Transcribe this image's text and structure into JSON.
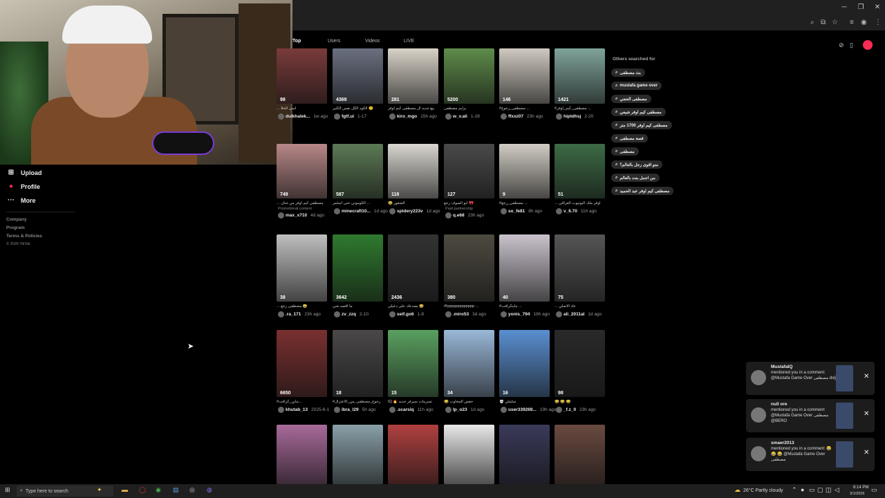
{
  "sidebar": {
    "items": [
      {
        "label": "Upload",
        "icon": "plus-square-icon"
      },
      {
        "label": "Profile",
        "icon": "profile-icon"
      },
      {
        "label": "More",
        "icon": "more-icon"
      }
    ],
    "footer": [
      "Company",
      "Program",
      "Terms & Policies",
      "© 2026 TikTok"
    ]
  },
  "tabs": [
    {
      "label": "Top",
      "active": true
    },
    {
      "label": "Users",
      "active": false
    },
    {
      "label": "Videos",
      "active": false
    },
    {
      "label": "LIVE",
      "active": false
    }
  ],
  "videos": [
    {
      "likes": "98",
      "caption": "... أمنى الحلا",
      "user": "dulkhalek...",
      "time": "1w ago",
      "thumb": "#7a3b3b"
    },
    {
      "likes": "4369",
      "caption": "الكود الكل نفس الكثير 😊",
      "user": "fgtf.ui",
      "time": "1-17",
      "thumb": "#6a7080"
    },
    {
      "likes": "281",
      "caption": "بيع جديد ال مصطفى كيم اوفر",
      "user": "kiro_mgo",
      "time": "15h ago",
      "thumb": "#d8d2c8"
    },
    {
      "likes": "5200",
      "caption": "برايم مصطفى",
      "user": "w_v.ali",
      "time": "1-28",
      "thumb": "#5e8c4a"
    },
    {
      "likes": "146",
      "caption": "#مصطفى_رجوع ...",
      "user": "ffxxz07",
      "time": "23h ago",
      "thumb": "#cfc9c0"
    },
    {
      "likes": "1421",
      "caption": "#مصطفى_كيم_اوفر ...",
      "user": "hiptdhsj",
      "time": "2-20",
      "thumb": "#7fa39a"
    },
    {
      "likes": "749",
      "caption": "... مصطفى كيم اوفر من جنان",
      "user": "max_x710",
      "time": "4d ago",
      "thumb": "#b88888",
      "extra": "Promotional content"
    },
    {
      "likes": "587",
      "caption": "الكوموني حتى اسلمر ...",
      "user": "minecraft10...",
      "time": "1d ago",
      "thumb": "#5c7a55"
    },
    {
      "likes": "118",
      "caption": "😂 الشغور",
      "user": "spidery223v",
      "time": "1d ago",
      "thumb": "#d9d6d0"
    },
    {
      "likes": "127",
      "caption": "ابو الصوف رجع 🎀",
      "user": "q.e68",
      "time": "23h ago",
      "thumb": "#4a4a4a",
      "extra": "Paid partnership"
    },
    {
      "likes": "9",
      "caption": "#مصطفى_رجع ...",
      "user": "so_fe81",
      "time": "8h ago",
      "thumb": "#d1ccc4"
    },
    {
      "likes": "51",
      "caption": "... اوفر ملك اليوتيوب العراقي",
      "user": "v_6.70",
      "time": "11h ago",
      "thumb": "#3d6b45"
    },
    {
      "likes": "38",
      "caption": "... مصطفى رجع 😂",
      "user": ".ra_171",
      "time": "23h ago",
      "thumb": "#bfbfbf"
    },
    {
      "likes": "3642",
      "caption": "ما اقصد شي",
      "user": "zv_zzq",
      "time": "2-10",
      "thumb": "#2f7a2f"
    },
    {
      "likes": "2436",
      "caption": "يصدعك على دعيلي 😂",
      "user": "seif.go6",
      "time": "1-8",
      "thumb": "#333"
    },
    {
      "likes": "380",
      "caption": "#fypppppppppppp ...",
      "user": ".miro53",
      "time": "3d ago",
      "thumb": "#4d4a40"
    },
    {
      "likes": "40",
      "caption": "#ماينكرافت ...",
      "user": "yonis_794",
      "time": "19h ago",
      "thumb": "#c9c2cc"
    },
    {
      "likes": "75",
      "caption": "... عاد الاصلي",
      "user": "ali_2011al",
      "time": "1d ago",
      "thumb": "#555"
    },
    {
      "likes": "6650",
      "caption": "#ماين_كرافت...",
      "user": "khutab_13",
      "time": "2025-6-1",
      "thumb": "#7a3030"
    },
    {
      "likes": "18",
      "caption": "#رجوع_مصطفى_من_الاعتزال",
      "user": "ibra_l29",
      "time": "5h ago",
      "thumb": "#4a4848"
    },
    {
      "likes": "15",
      "caption": "IQ 🔥 تسريبات سيرفر جديد",
      "user": ".scarsiq",
      "time": "11h ago",
      "thumb": "#5aa060"
    },
    {
      "likes": "34",
      "caption": "😂 حفص المحاوب",
      "user": "lp_o23",
      "time": "1d ago",
      "thumb": "#9ab8d8"
    },
    {
      "likes": "16",
      "caption": "💀 سلملي",
      "user": "user339269...",
      "time": "19h ago",
      "thumb": "#5a8fd0"
    },
    {
      "likes": "98",
      "caption": "😂 😂 😂",
      "user": "_f.z_0",
      "time": "23h ago",
      "thumb": "#2a2a2a"
    },
    {
      "likes": "",
      "caption": "",
      "user": "",
      "time": "",
      "thumb": "#a86a9a"
    },
    {
      "likes": "",
      "caption": "",
      "user": "",
      "time": "",
      "thumb": "#8aa0a8"
    },
    {
      "likes": "",
      "caption": "",
      "user": "",
      "time": "",
      "thumb": "#b04040"
    },
    {
      "likes": "",
      "caption": "",
      "user": "",
      "time": "",
      "thumb": "#e8e8e8"
    },
    {
      "likes": "",
      "caption": "",
      "user": "",
      "time": "",
      "thumb": "#3a3a5a"
    },
    {
      "likes": "",
      "caption": "",
      "user": "",
      "time": "",
      "thumb": "#6a4a40"
    }
  ],
  "others_searched": {
    "title": "Others searched for",
    "items": [
      "بث مصطفى",
      "mustafa game over",
      "مصطفى الحجي",
      "مصطفى كيم اوفر شيعي",
      "مصطفى كيم اوفر 1700 متر",
      "قصة مصطفى",
      "مصطفى",
      "منو اقوى رجل بالعالم؟",
      "من اجمل بنت بالعالم",
      "مصطفى كيم اوفر عبد الحميد"
    ]
  },
  "notifications": [
    {
      "name": "MustafaIQ",
      "text": "mentioned you in a comment: @Mustafa Game Over مصطفى dslj"
    },
    {
      "name": "null ore",
      "text": "mentioned you in a comment: @Mustafa Game Over مصطفى @BERO"
    },
    {
      "name": "smaer2013",
      "text": "mentioned you in a comment: 😂 😂 😂 @Mustafa Game Over مصطفى"
    }
  ],
  "taskbar": {
    "search_placeholder": "Type here to search",
    "weather": "26°C Partly cloudy",
    "time": "8:14 PM",
    "date": "3/1/2026"
  },
  "colors": {
    "accent": "#fe2c55",
    "background": "#000000"
  }
}
